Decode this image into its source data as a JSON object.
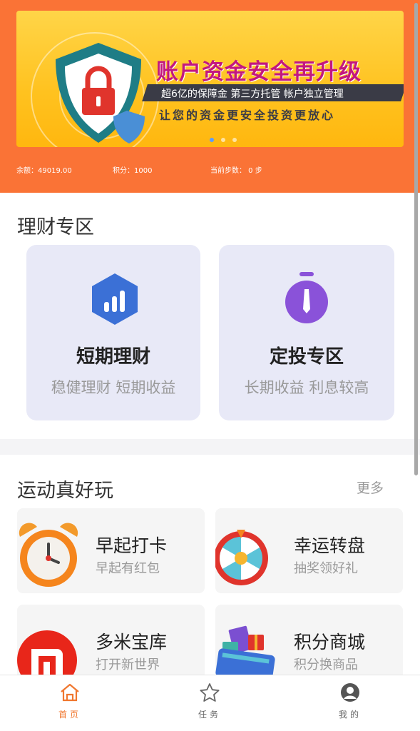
{
  "banner": {
    "title": "账户资金安全再升级",
    "subtitle": "超6亿的保障金  第三方托管  帐户独立管理",
    "tagline": "让您的资金更安全投资更放心",
    "carousel_dots": 3,
    "active_dot": 0
  },
  "stats": {
    "balance": "余额：49019.00",
    "points": "积分：1000",
    "steps": "当前步数： 0 步"
  },
  "finance": {
    "title": "理财专区",
    "cards": [
      {
        "title": "短期理财",
        "subtitle": "稳健理财 短期收益",
        "icon": "bar-chart-hexagon-icon"
      },
      {
        "title": "定投专区",
        "subtitle": "长期收益 利息较高",
        "icon": "stopwatch-icon"
      }
    ]
  },
  "sports": {
    "title": "运动真好玩",
    "more": "更多",
    "items": [
      {
        "title": "早起打卡",
        "subtitle": "早起有红包",
        "icon": "alarm-clock-icon"
      },
      {
        "title": "幸运转盘",
        "subtitle": "抽奖领好礼",
        "icon": "lucky-wheel-icon"
      },
      {
        "title": "多米宝库",
        "subtitle": "打开新世界",
        "icon": "mi-logo-icon"
      },
      {
        "title": "积分商城",
        "subtitle": "积分换商品",
        "icon": "shopping-gifts-icon"
      }
    ]
  },
  "tabs": [
    {
      "label": "首页",
      "icon": "home-icon",
      "active": true
    },
    {
      "label": "任务",
      "icon": "star-icon",
      "active": false
    },
    {
      "label": "我的",
      "icon": "user-icon",
      "active": false
    }
  ],
  "colors": {
    "brand": "#fa7336",
    "active_tab": "#f0772f",
    "inactive_tab": "#666666",
    "card_bg": "#e8e9f7"
  }
}
